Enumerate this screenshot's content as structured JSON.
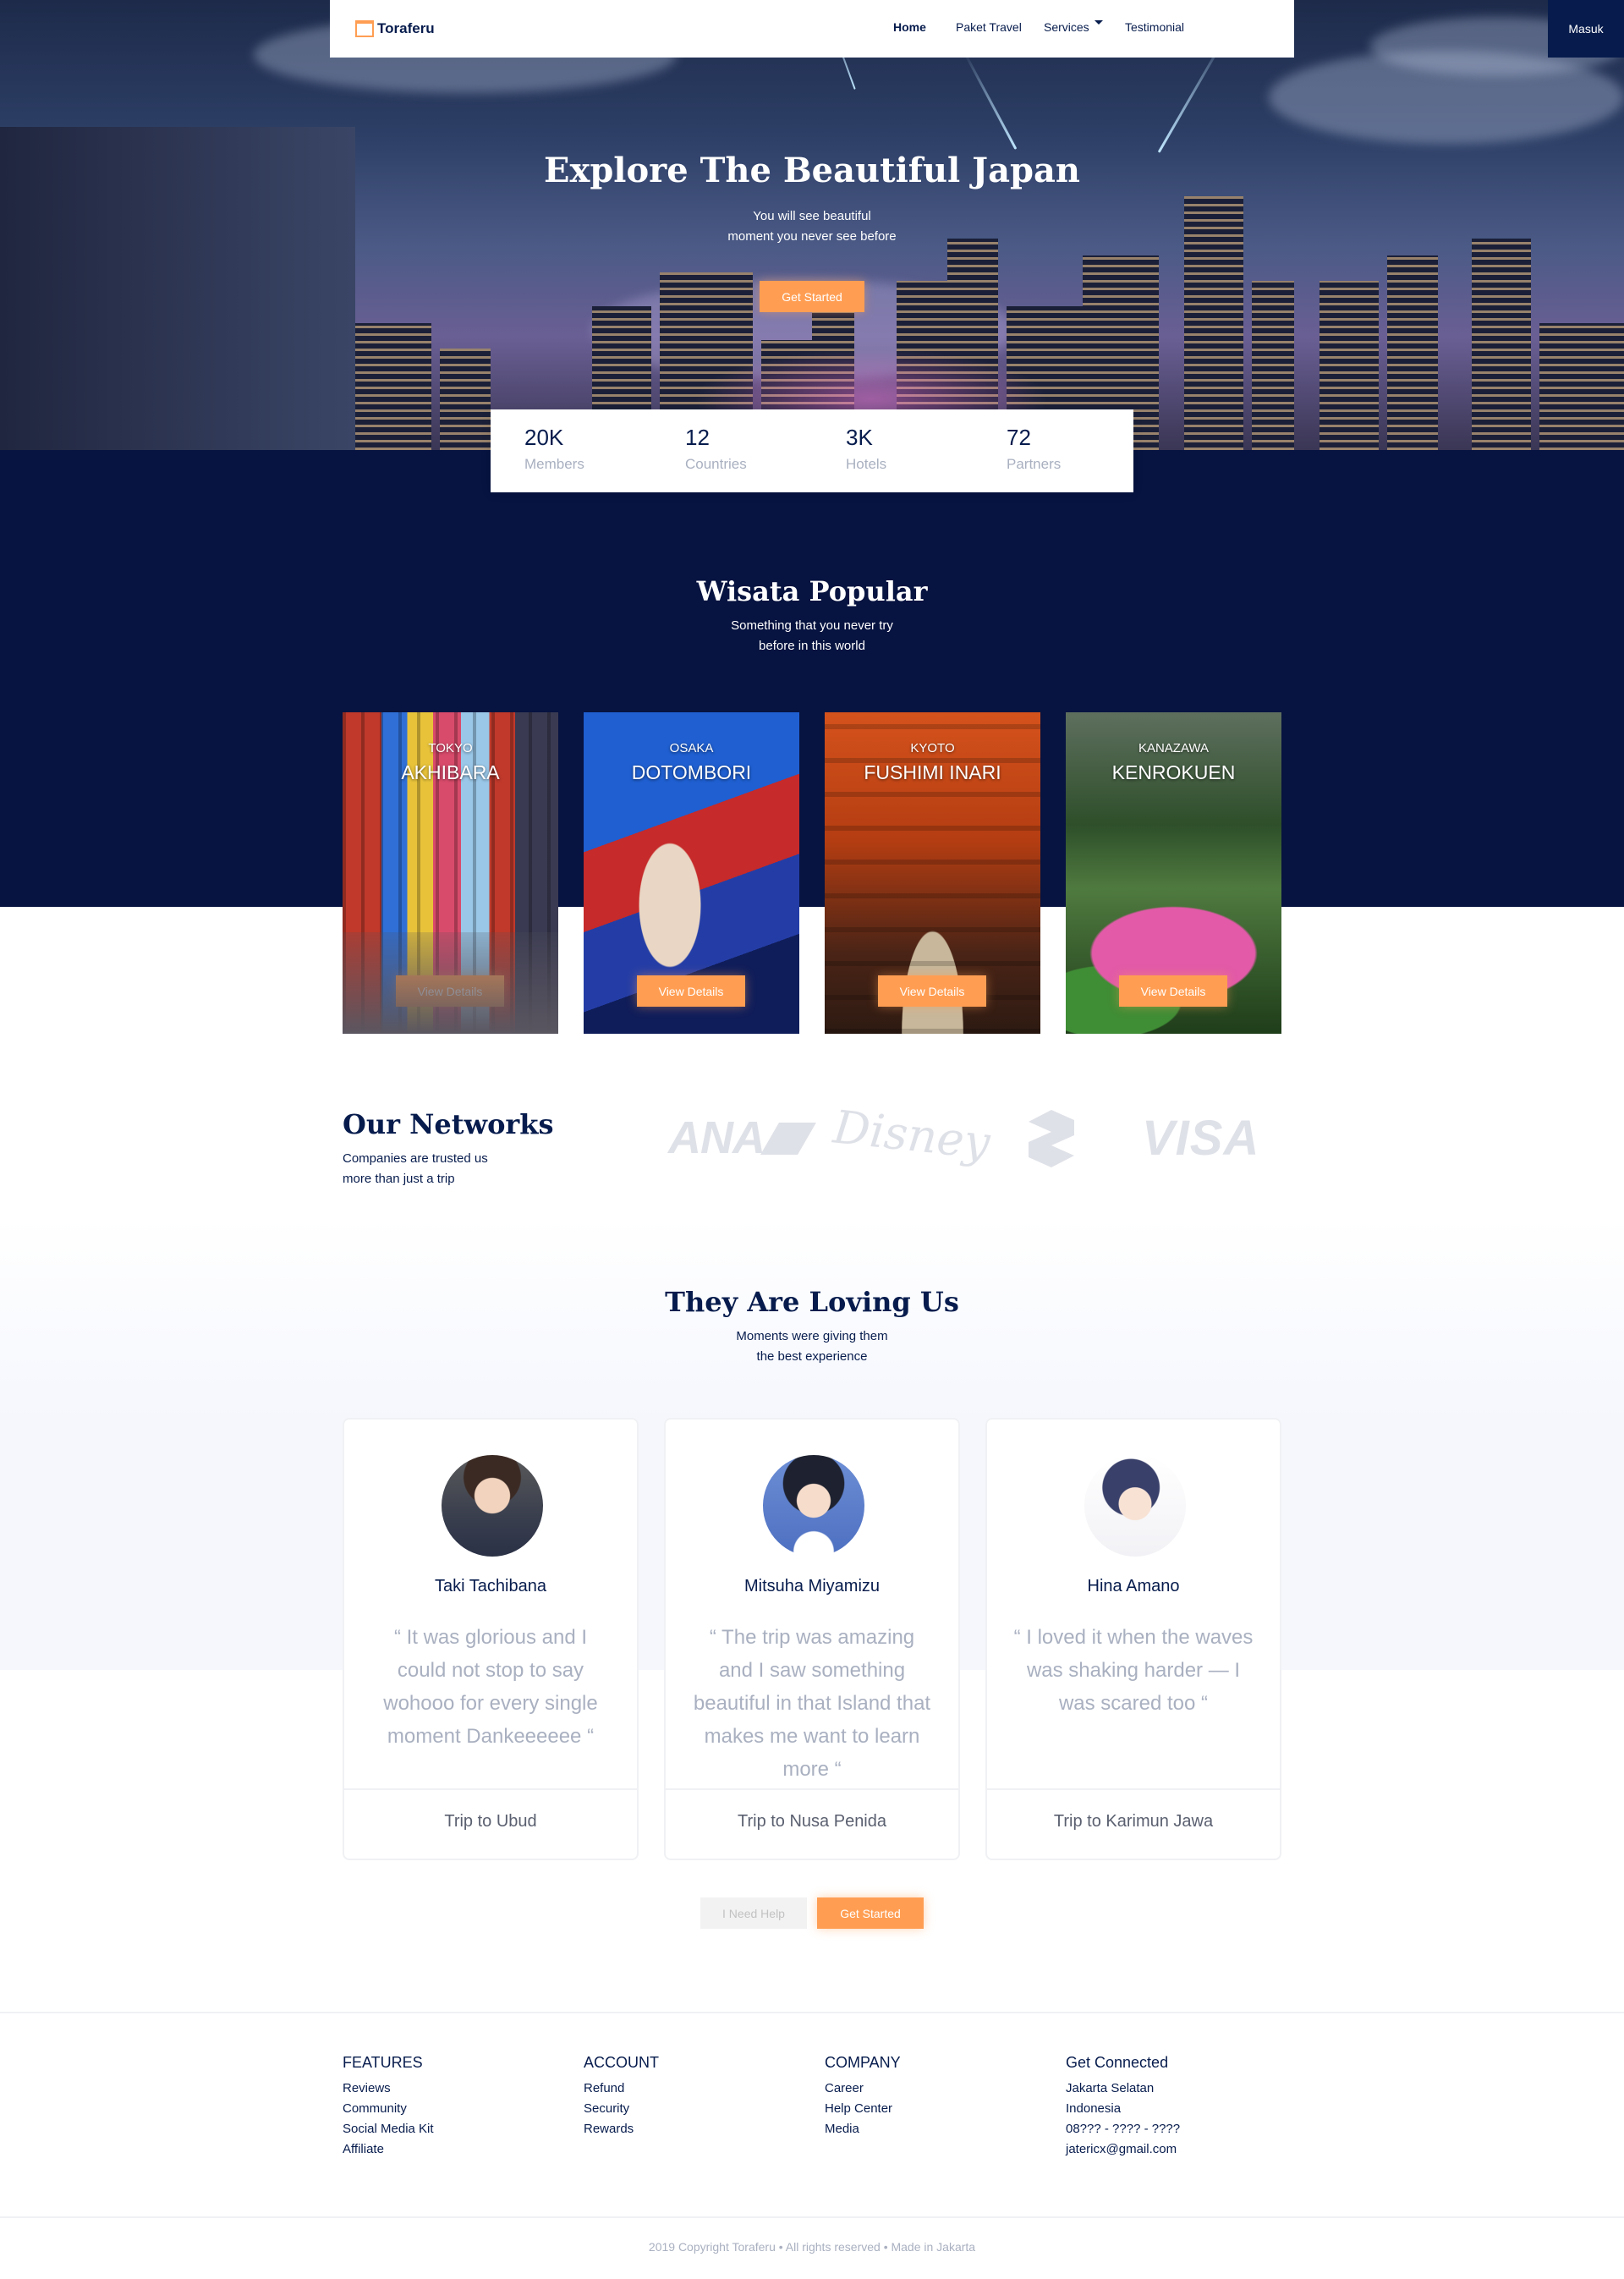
{
  "navbar": {
    "brand": "Toraferu",
    "links": {
      "home": "Home",
      "paket": "Paket Travel",
      "services": "Services",
      "testimonial": "Testimonial"
    },
    "login": "Masuk"
  },
  "hero": {
    "title": "Explore The Beautiful Japan",
    "subtitle_line1": "You will see beautiful",
    "subtitle_line2": "moment you never see before",
    "cta": "Get Started"
  },
  "stats": [
    {
      "value": "20K",
      "label": "Members"
    },
    {
      "value": "12",
      "label": "Countries"
    },
    {
      "value": "3K",
      "label": "Hotels"
    },
    {
      "value": "72",
      "label": "Partners"
    }
  ],
  "popular": {
    "title": "Wisata Popular",
    "subtitle_line1": "Something that you never try",
    "subtitle_line2": "before in this world",
    "cards": [
      {
        "city": "TOKYO",
        "place": "AKHIBARA",
        "button": "View Details"
      },
      {
        "city": "OSAKA",
        "place": "DOTOMBORI",
        "button": "View Details"
      },
      {
        "city": "KYOTO",
        "place": "FUSHIMI INARI",
        "button": "View Details"
      },
      {
        "city": "KANAZAWA",
        "place": "KENROKUEN",
        "button": "View Details"
      }
    ]
  },
  "networks": {
    "title": "Our Networks",
    "subtitle_line1": "Companies are trusted us",
    "subtitle_line2": "more than just a trip",
    "logos": [
      "ANA",
      "Disney",
      "VISA"
    ]
  },
  "testimonials": {
    "title": "They Are Loving Us",
    "subtitle_line1": "Moments were giving them",
    "subtitle_line2": "the best experience",
    "items": [
      {
        "name": "Taki Tachibana",
        "quote": "“ It was glorious and I could not stop to say wohooo for every single moment Dankeeeeee “",
        "trip": "Trip to Ubud"
      },
      {
        "name": "Mitsuha Miyamizu",
        "quote": "“ The trip was amazing and I saw something beautiful in that Island that makes me want to learn more “",
        "trip": "Trip to Nusa Penida"
      },
      {
        "name": "Hina Amano",
        "quote": "“ I loved it when the waves was shaking harder — I was scared too “",
        "trip": "Trip to Karimun Jawa"
      }
    ],
    "help_button": "I Need Help",
    "start_button": "Get Started"
  },
  "footer": {
    "columns": [
      {
        "heading": "FEATURES",
        "links": [
          "Reviews",
          "Community",
          "Social Media Kit",
          "Affiliate"
        ]
      },
      {
        "heading": "ACCOUNT",
        "links": [
          "Refund",
          "Security",
          "Rewards"
        ]
      },
      {
        "heading": "COMPANY",
        "links": [
          "Career",
          "Help Center",
          "Media"
        ]
      },
      {
        "heading": "Get Connected",
        "links": [
          "Jakarta Selatan",
          "Indonesia",
          "08??? - ???? - ????",
          "jatericx@gmail.com"
        ]
      }
    ],
    "copyright": "2019 Copyright Toraferu • All rights reserved • Made in Jakarta"
  },
  "colors": {
    "navy": "#071c4d",
    "accent": "#ff9e53",
    "muted": "#a9b0c0"
  }
}
